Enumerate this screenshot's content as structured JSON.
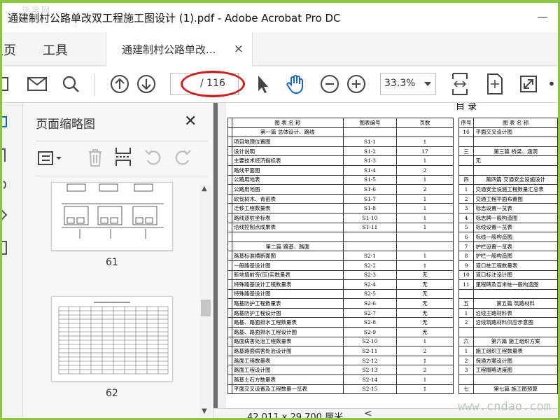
{
  "window": {
    "title": "通建制村公路单改双工程施工图设计 (1).pdf - Adobe Acrobat Pro DC",
    "watermark_top": "活学网"
  },
  "menu": {
    "home": "主页",
    "tools": "工具"
  },
  "tab": {
    "label": "通建制村公路单改...",
    "close": "×"
  },
  "toolbar": {
    "page_current": "",
    "page_total": "/ 116",
    "zoom": "33.3%"
  },
  "panel": {
    "title": "页面缩略图",
    "close": "✕",
    "thumbnails": [
      {
        "page": "61"
      },
      {
        "page": "62"
      }
    ]
  },
  "doc": {
    "top_header": "目 录",
    "headers": {
      "seq": "序号",
      "name": "图 表 名 称",
      "code": "图表编号",
      "pages": "页数",
      "seq2": "序号",
      "name2": "图 表 名 称"
    },
    "rows": [
      {
        "n": "第一篇 总体设计、路线",
        "c": "",
        "p": "",
        "s": "16",
        "r": "平面交叉设计图"
      },
      {
        "n": "项目地理位置图",
        "c": "S1-1",
        "p": "1",
        "s": "",
        "r": ""
      },
      {
        "n": "设计说明",
        "c": "S1-2",
        "p": "17",
        "s": "三",
        "r": "第三篇 桥梁、涵洞"
      },
      {
        "n": "主要技术经济指标表",
        "c": "S1-3",
        "p": "1",
        "s": "",
        "r": "无"
      },
      {
        "n": "路线平面图",
        "c": "S1-4",
        "p": "2",
        "s": "",
        "r": ""
      },
      {
        "n": "公路用地表",
        "c": "S1-5",
        "p": "1",
        "s": "四",
        "r": "第四篇 交通安全设施设计"
      },
      {
        "n": "公路用地图",
        "c": "S1-6",
        "p": "2",
        "s": "1",
        "r": "交通安全设施工程数量汇总表"
      },
      {
        "n": "砍伐树木、青苗表",
        "c": "S1-7",
        "p": "1",
        "s": "2",
        "r": "交通工程平面布置图"
      },
      {
        "n": "迁移工程数量表",
        "c": "S1-8",
        "p": "1",
        "s": "3",
        "r": "标志设置一览表"
      },
      {
        "n": "路线逐桩坐标表",
        "c": "S1-10",
        "p": "1",
        "s": "4",
        "r": "标志牌一般构造图"
      },
      {
        "n": "沿线控制点成果表",
        "c": "S1-11",
        "p": "1",
        "s": "5",
        "r": "标线设置一览表"
      },
      {
        "n": "",
        "c": "",
        "p": "",
        "s": "6",
        "r": "标线一般构造图"
      },
      {
        "n": "第二篇 路基、路面",
        "c": "",
        "p": "",
        "s": "7",
        "r": "护栏设置一览表"
      },
      {
        "n": "路基标准横断面图",
        "c": "S2-1",
        "p": "1",
        "s": "8",
        "r": "护栏一般构造图"
      },
      {
        "n": "一般路基设计图",
        "c": "S2-2",
        "p": "1",
        "s": "9",
        "r": "道口桩工程数量表"
      },
      {
        "n": "新地填前夯(压)实数量表",
        "c": "S2-3",
        "p": "无",
        "s": "10",
        "r": "道口标注设计图"
      },
      {
        "n": "特殊路基设计工程数量表",
        "c": "S2-4",
        "p": "无",
        "s": "11",
        "r": "里程碑及百米桩一般构造图"
      },
      {
        "n": "特殊路基设计图",
        "c": "S2-5",
        "p": "无",
        "s": "",
        "r": ""
      },
      {
        "n": "路基防护工程数量表",
        "c": "S2-6",
        "p": "无",
        "s": "五",
        "r": "第五篇 筑路材料"
      },
      {
        "n": "路基防护工程设计图",
        "c": "S2-7",
        "p": "无",
        "s": "1",
        "r": "沿线主路材料表"
      },
      {
        "n": "路基、路面排水工程数量表",
        "c": "S2-8",
        "p": "无",
        "s": "2",
        "r": "沿线筑路材料供应示意图"
      },
      {
        "n": "路基、路面排水工程设计图",
        "c": "S2-9",
        "p": "无",
        "s": "",
        "r": ""
      },
      {
        "n": "路面病害处治工程数量表",
        "c": "S2-10",
        "p": "1",
        "s": "六",
        "r": "第六篇 施工组织方案"
      },
      {
        "n": "路基路面病害处治设计图",
        "c": "S2-11",
        "p": "2",
        "s": "1",
        "r": "施工组织工程数量表"
      },
      {
        "n": "路面工程数量表",
        "c": "S2-12",
        "p": "1",
        "s": "2",
        "r": "保通方案设计图"
      },
      {
        "n": "路面工程设计图",
        "c": "S2-13",
        "p": "2",
        "s": "3",
        "r": "工程概略进度图"
      },
      {
        "n": "路基土石方数量表",
        "c": "S2-14",
        "p": "1",
        "s": "",
        "r": ""
      },
      {
        "n": "平面交叉设置及工程数量一览表",
        "c": "S2-15",
        "p": "1",
        "s": "七",
        "r": "第七篇 施工图预算"
      }
    ]
  },
  "status": {
    "dimensions": "42.011 x 29.700 厘米",
    "left_arrow": "<",
    "watermark": "www.cndao.com"
  }
}
